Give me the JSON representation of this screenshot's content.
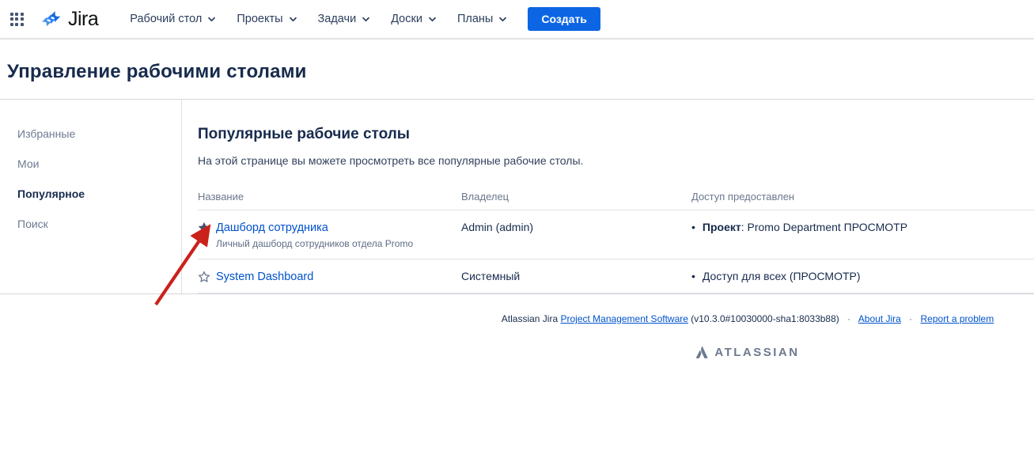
{
  "nav": {
    "logo_text": "Jira",
    "items": [
      {
        "label": "Рабочий стол"
      },
      {
        "label": "Проекты"
      },
      {
        "label": "Задачи"
      },
      {
        "label": "Доски"
      },
      {
        "label": "Планы"
      }
    ],
    "create_button": "Создать"
  },
  "page": {
    "title": "Управление рабочими столами"
  },
  "sidebar": {
    "items": [
      {
        "label": "Избранные",
        "active": false
      },
      {
        "label": "Мои",
        "active": false
      },
      {
        "label": "Популярное",
        "active": true
      },
      {
        "label": "Поиск",
        "active": false
      }
    ]
  },
  "main": {
    "heading": "Популярные рабочие столы",
    "description": "На этой странице вы можете просмотреть все популярные рабочие столы.",
    "table": {
      "headers": [
        "Название",
        "Владелец",
        "Доступ предоставлен"
      ],
      "rows": [
        {
          "starred": true,
          "name": "Дашборд сотрудника",
          "subtitle": "Личный дашборд сотрудников отдела Promo",
          "owner": "Admin (admin)",
          "access_bullet": "•",
          "access_bold": "Проект",
          "access_rest": ": Promo Department ПРОСМОТР"
        },
        {
          "starred": false,
          "name": "System Dashboard",
          "owner": "Системный",
          "access_bullet": "•",
          "access_rest": "Доступ для всех (ПРОСМОТР)"
        }
      ]
    }
  },
  "footer": {
    "prefix": "Atlassian Jira",
    "software_link": "Project Management Software",
    "version": "(v10.3.0#10030000-sha1:8033b88)",
    "separator": "·",
    "about_link": "About Jira",
    "report_link": "Report a problem",
    "brand": "ATLASSIAN"
  },
  "colors": {
    "accent_blue": "#0C66E4",
    "link_blue": "#0052CC",
    "star_filled": "#42526E",
    "star_outline": "#6B778C",
    "annotation_arrow_red": "#CB211B",
    "atlassian_gray": "#6C798F"
  }
}
